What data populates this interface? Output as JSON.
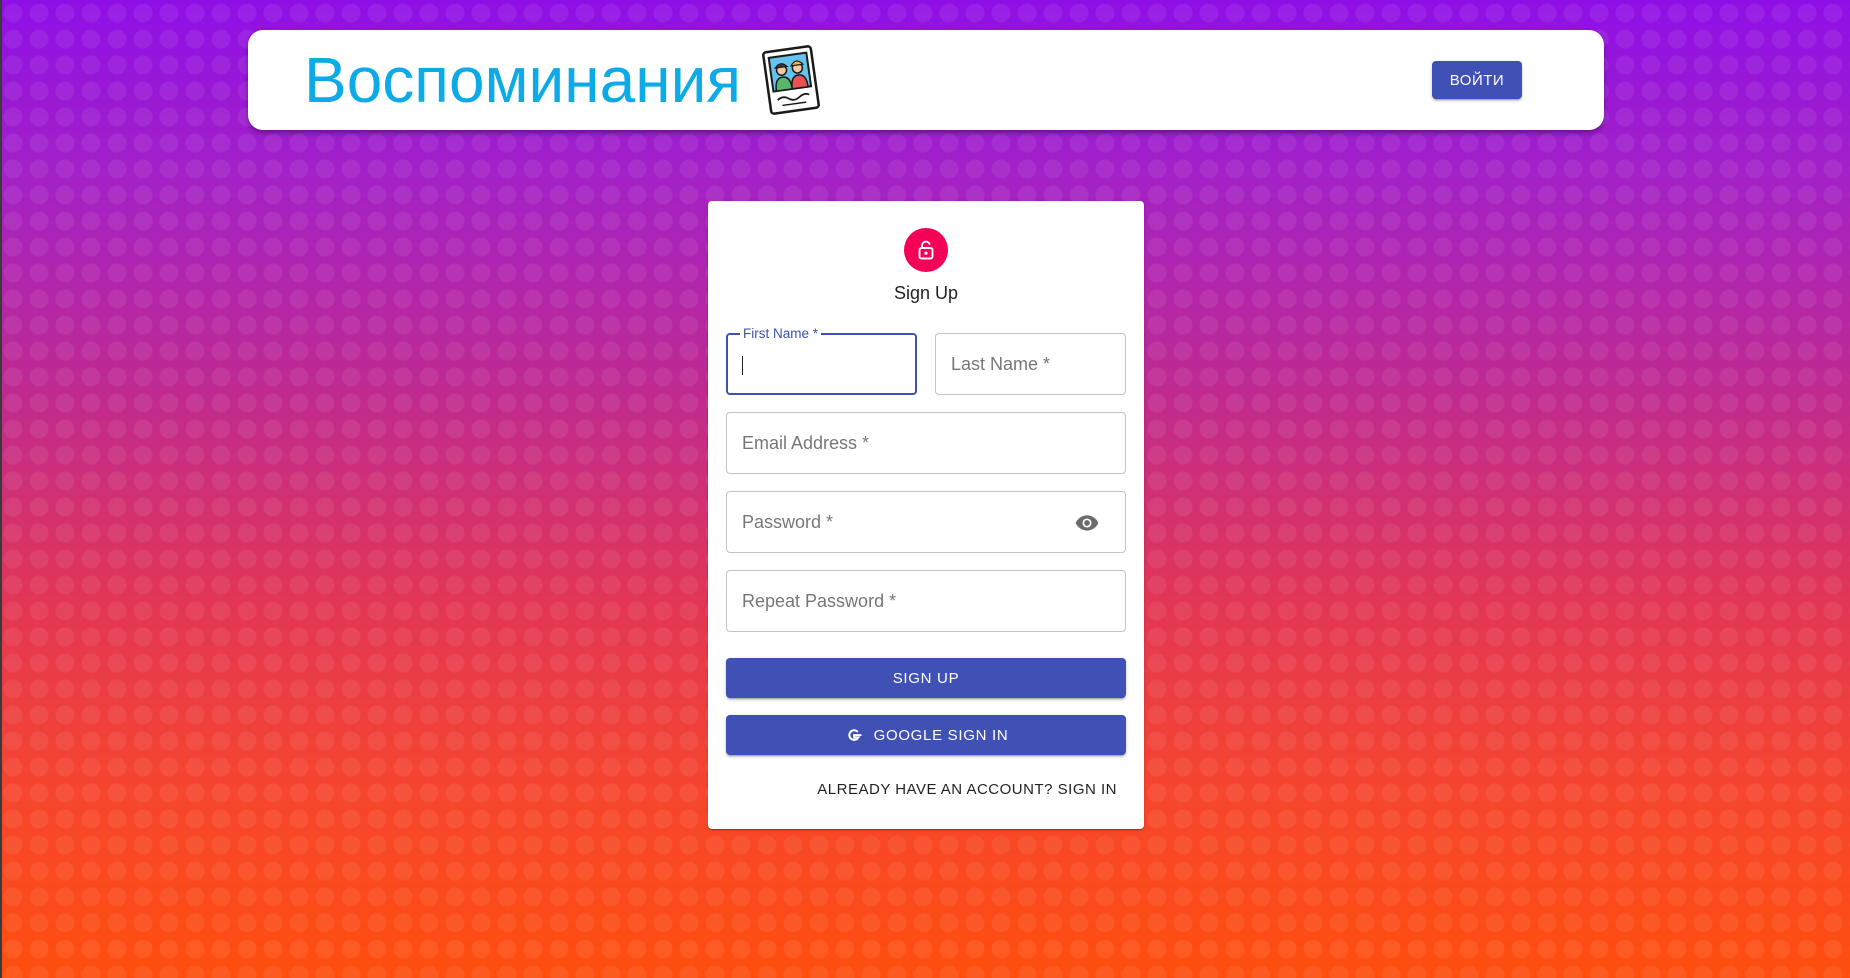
{
  "header": {
    "brand_title": "Воспоминания",
    "logo_icon": "memories-photo-icon",
    "login_label": "ВОЙТИ",
    "brand_color": "#0daae8"
  },
  "form": {
    "title": "Sign Up",
    "avatar_icon": "lock-icon",
    "avatar_color": "#f50057",
    "fields": {
      "first_name": {
        "label": "First Name *",
        "value": ""
      },
      "last_name": {
        "label": "Last Name *",
        "value": ""
      },
      "email": {
        "label": "Email Address *",
        "value": ""
      },
      "password": {
        "label": "Password *",
        "value": ""
      },
      "repeat_password": {
        "label": "Repeat Password *",
        "value": ""
      }
    },
    "password_toggle_icon": "eye-icon",
    "signup_label": "SIGN UP",
    "google_label": "GOOGLE SIGN IN",
    "google_icon": "google-icon",
    "switch_label": "ALREADY HAVE AN ACCOUNT? SIGN IN",
    "primary_color": "#3f51b5"
  }
}
